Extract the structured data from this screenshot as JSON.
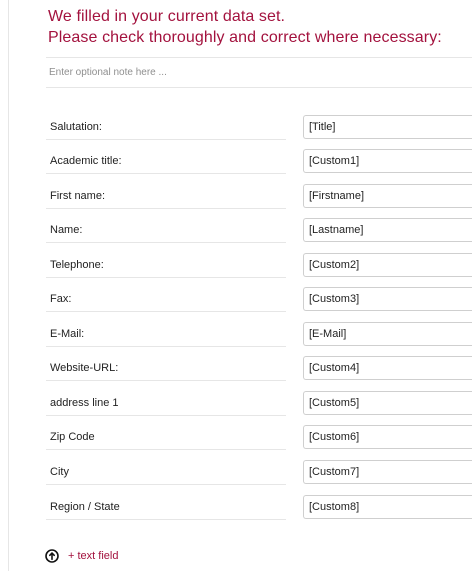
{
  "heading": {
    "line1": "We filled in your current data set.",
    "line2": "Please check thoroughly and correct where necessary:"
  },
  "note": {
    "value": "",
    "placeholder": "Enter optional note here ..."
  },
  "fields": [
    {
      "label": "Salutation:",
      "value": "[Title]"
    },
    {
      "label": "Academic title:",
      "value": "[Custom1]"
    },
    {
      "label": "First name:",
      "value": "[Firstname]"
    },
    {
      "label": "Name:",
      "value": "[Lastname]"
    },
    {
      "label": "Telephone:",
      "value": "[Custom2]"
    },
    {
      "label": "Fax:",
      "value": "[Custom3]"
    },
    {
      "label": "E-Mail:",
      "value": "[E-Mail]"
    },
    {
      "label": "Website-URL:",
      "value": "[Custom4]"
    },
    {
      "label": "address line 1",
      "value": "[Custom5]"
    },
    {
      "label": "Zip Code",
      "value": "[Custom6]"
    },
    {
      "label": "City",
      "value": "[Custom7]"
    },
    {
      "label": "Region / State",
      "value": "[Custom8]"
    }
  ],
  "add_field": {
    "label": "+ text field",
    "icon": "up-arrow-circle-icon"
  },
  "colors": {
    "accent": "#a3123e",
    "text": "#222222",
    "border": "#cfcfcf",
    "rule": "#e6e6e6"
  }
}
